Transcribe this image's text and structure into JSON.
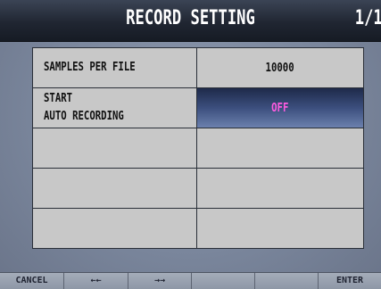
{
  "header": {
    "title": "RECORD SETTING",
    "page_indicator": "1/1"
  },
  "settings": [
    {
      "label": "SAMPLES PER FILE",
      "value": "10000"
    },
    {
      "label": "START\nAUTO RECORDING",
      "value": "OFF"
    },
    {
      "label": "",
      "value": ""
    },
    {
      "label": "",
      "value": ""
    },
    {
      "label": "",
      "value": ""
    }
  ],
  "footer": {
    "keys": [
      "CANCEL",
      "←←",
      "→→",
      "",
      "",
      "ENTER"
    ]
  },
  "colors": {
    "selected_value": "#ff5ce0",
    "title_bar": "#202632",
    "cell": "#c8c8c8"
  }
}
